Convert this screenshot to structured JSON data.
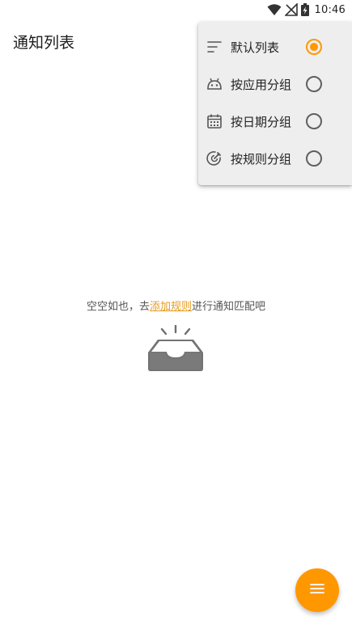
{
  "status_bar": {
    "time": "10:46",
    "icons": [
      "wifi-icon",
      "no-signal-icon",
      "battery-charging-icon"
    ]
  },
  "header": {
    "title": "通知列表"
  },
  "menu": {
    "items": [
      {
        "label": "默认列表",
        "icon": "list-lines-icon",
        "checked": true
      },
      {
        "label": "按应用分组",
        "icon": "android-icon",
        "checked": false
      },
      {
        "label": "按日期分组",
        "icon": "calendar-icon",
        "checked": false
      },
      {
        "label": "按规则分组",
        "icon": "target-icon",
        "checked": false
      }
    ]
  },
  "empty_state": {
    "text_before": "空空如也，去",
    "link_text": "添加规则",
    "text_after": "进行通知匹配吧",
    "illustration": "empty-inbox-icon"
  },
  "fab": {
    "icon": "menu-icon"
  },
  "colors": {
    "accent": "#ff9800",
    "link": "#e69b1f",
    "menu_background": "#eeeeee"
  }
}
